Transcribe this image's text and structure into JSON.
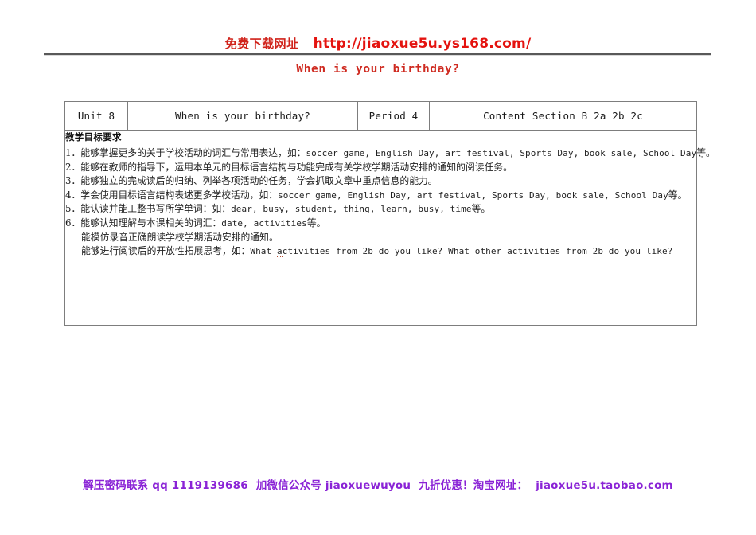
{
  "promo_header": {
    "label_cn": "免费下载网址",
    "url": "http://jiaoxue5u.ys168.com/",
    "label_color": "#d0231b",
    "url_color": "#e4130f"
  },
  "doc_title": {
    "text": "When is your birthday?",
    "color": "#cf2b21"
  },
  "lesson_table": {
    "header": {
      "unit": "Unit 8",
      "topic": "When is your birthday?",
      "period": "Period 4",
      "content": "Content  Section B  2a 2b 2c"
    },
    "body": {
      "goals_heading": "教学目标要求",
      "goals": [
        {
          "cn_before": "1．能够掌握更多的关于学校活动的词汇与常用表达，如：",
          "en": "soccer game, English Day, art festival, Sports Day, book sale, School Day",
          "cn_after": "等。",
          "indented": false
        },
        {
          "cn_before": "2．能够在教师的指导下，运用本单元的目标语言结构与功能完成有关学校学期活动安排的通知的阅读任务。",
          "en": "",
          "cn_after": "",
          "indented": false
        },
        {
          "cn_before": "3．能够独立的完成读后的归纳、列举各项活动的任务，学会抓取文章中重点信息的能力。",
          "en": "",
          "cn_after": "",
          "indented": false
        },
        {
          "cn_before": "4．学会使用目标语言结构表述更多学校活动，如：",
          "en": "soccer game, English Day, art festival, Sports Day, book sale, School Day",
          "cn_after": "等。",
          "indented": false
        },
        {
          "cn_before": "5．能认读并能工整书写所学单词：如：",
          "en": "dear, busy, student, thing, learn, busy, time",
          "cn_after": "等。",
          "indented": false
        },
        {
          "cn_before": "6．能够认知理解与本课相关的词汇：",
          "en": "date, activities",
          "cn_after": "等。",
          "indented": false
        },
        {
          "cn_before": "能模仿录音正确朗读学校学期活动安排的通知。",
          "en": "",
          "cn_after": "",
          "indented": true
        },
        {
          "cn_before": "能够进行阅读后的开放性拓展思考，如：",
          "en_misspelled": "a",
          "en": "ctivities from 2b do you like? What other activities from 2b do you like?",
          "en_lead": "What ",
          "cn_after": "",
          "indented": true
        }
      ]
    }
  },
  "footer_promo": {
    "segment1": "解压密码联系 qq 1119139686",
    "segment2": "加微信公众号 jiaoxuewuyou",
    "segment3": "九折优惠！淘宝网址：",
    "segment4": "jiaoxue5u.taobao.com",
    "color": "#8a23d6"
  }
}
